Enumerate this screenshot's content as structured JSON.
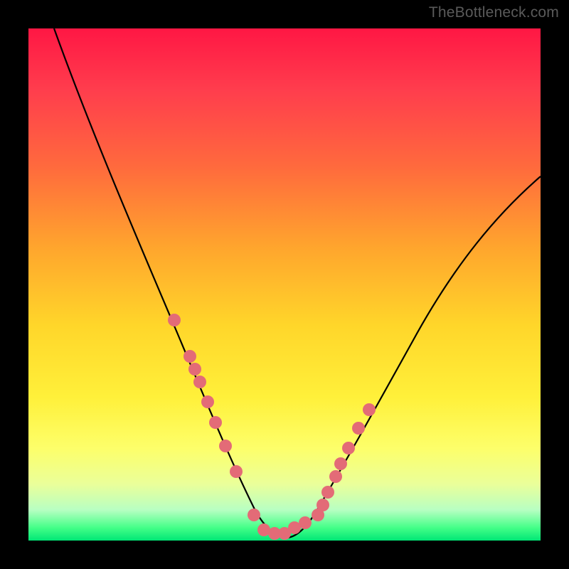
{
  "watermark": "TheBottleneck.com",
  "colors": {
    "frame_bg": "#000000",
    "gradient_top": "#ff1744",
    "gradient_mid": "#ffd62a",
    "gradient_bottom": "#00e676",
    "curve": "#000000",
    "dots": "#e36b77"
  },
  "chart_data": {
    "type": "line",
    "title": "",
    "xlabel": "",
    "ylabel": "",
    "xlim": [
      0,
      100
    ],
    "ylim": [
      0,
      100
    ],
    "grid": false,
    "legend": false,
    "series": [
      {
        "name": "curve",
        "x": [
          5,
          10,
          15,
          20,
          24,
          28,
          32,
          35,
          38,
          40,
          42,
          44,
          46,
          48,
          50,
          52,
          54,
          57,
          60,
          64,
          68,
          72,
          78,
          85,
          92,
          100
        ],
        "y": [
          100,
          88,
          76,
          64,
          54,
          44,
          35,
          27,
          20,
          14,
          9,
          5,
          2,
          0.5,
          0,
          0.5,
          2,
          6,
          12,
          20,
          28,
          36,
          45,
          55,
          63,
          71
        ]
      }
    ],
    "scatter": [
      {
        "name": "dots-left",
        "x": [
          28.5,
          31.5,
          32.5,
          33.5,
          35.0,
          36.5,
          38.5,
          40.5
        ],
        "y": [
          43.0,
          36.0,
          33.5,
          31.0,
          27.0,
          23.0,
          18.5,
          13.5
        ]
      },
      {
        "name": "dots-right",
        "x": [
          56.5,
          57.5,
          58.5,
          60.0,
          61.0,
          62.5,
          64.5,
          66.5
        ],
        "y": [
          5.0,
          7.0,
          9.5,
          12.5,
          15.0,
          18.0,
          22.0,
          25.5
        ]
      },
      {
        "name": "dots-bottom",
        "x": [
          44.0,
          46.0,
          48.0,
          50.0,
          52.0,
          54.0
        ],
        "y": [
          5.0,
          2.0,
          1.5,
          1.5,
          2.5,
          3.5
        ]
      }
    ],
    "annotations": [
      {
        "text": "TheBottleneck.com",
        "pos": "top-right"
      }
    ]
  }
}
